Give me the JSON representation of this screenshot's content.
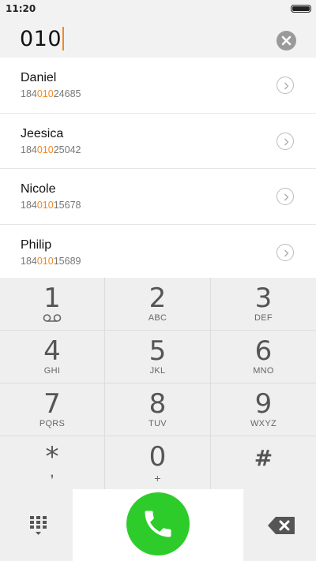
{
  "status_bar": {
    "time": "11:20"
  },
  "dial_input": {
    "prefix": "",
    "value": "010"
  },
  "contacts": [
    {
      "name": "Daniel",
      "number_start": "184",
      "number_match": "010",
      "number_end": "24685"
    },
    {
      "name": "Jeesica",
      "number_start": "184",
      "number_match": "010",
      "number_end": "25042"
    },
    {
      "name": "Nicole",
      "number_start": "184",
      "number_match": "010",
      "number_end": "15678"
    },
    {
      "name": "Philip",
      "number_start": "184",
      "number_match": "010",
      "number_end": "15689"
    }
  ],
  "keypad": [
    {
      "digit": "1",
      "letters": ""
    },
    {
      "digit": "2",
      "letters": "ABC"
    },
    {
      "digit": "3",
      "letters": "DEF"
    },
    {
      "digit": "4",
      "letters": "GHI"
    },
    {
      "digit": "5",
      "letters": "JKL"
    },
    {
      "digit": "6",
      "letters": "MNO"
    },
    {
      "digit": "7",
      "letters": "PQRS"
    },
    {
      "digit": "8",
      "letters": "TUV"
    },
    {
      "digit": "9",
      "letters": "WXYZ"
    },
    {
      "digit": "*",
      "letters": ","
    },
    {
      "digit": "0",
      "letters": "+"
    },
    {
      "digit": "#",
      "letters": ""
    }
  ],
  "icons": {
    "battery": "battery-icon",
    "clear": "clear-circle-icon",
    "detail": "chevron-right-circle-icon",
    "voicemail": "voicemail-icon",
    "dialpad_toggle": "dialpad-grid-icon",
    "call": "phone-icon",
    "backspace": "backspace-icon"
  },
  "colors": {
    "accent": "#f08a24",
    "call_green": "#2ecc2a",
    "keypad_bg": "#efefef"
  }
}
